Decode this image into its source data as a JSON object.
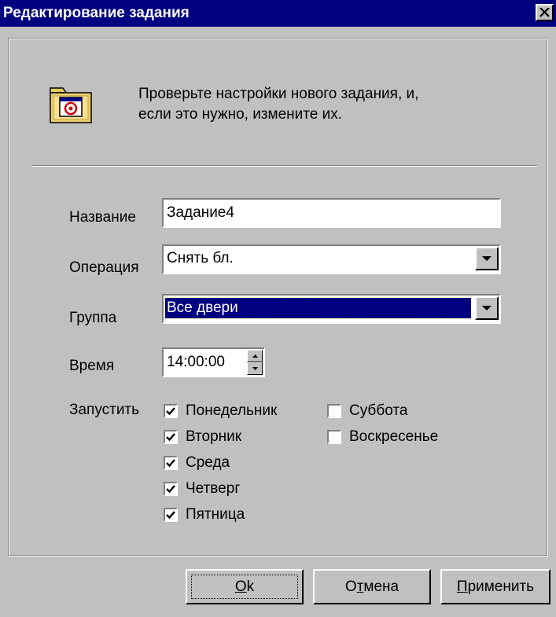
{
  "window": {
    "title": "Редактирование задания",
    "close_icon": "close-icon"
  },
  "header": {
    "icon": "folder-schedule-icon",
    "text_line1": "Проверьте настройки нового задания, и,",
    "text_line2": "если это нужно, измените их."
  },
  "form": {
    "name_label": "Название",
    "name_value": "Задание4",
    "operation_label": "Операция",
    "operation_value": "Снять бл.",
    "group_label": "Группа",
    "group_value": "Все двери",
    "time_label": "Время",
    "time_value": "14:00:00",
    "run_label": "Запустить"
  },
  "days": [
    {
      "label": "Понедельник",
      "checked": true
    },
    {
      "label": "Вторник",
      "checked": true
    },
    {
      "label": "Среда",
      "checked": true
    },
    {
      "label": "Четверг",
      "checked": true
    },
    {
      "label": "Пятница",
      "checked": true
    },
    {
      "label": "Суббота",
      "checked": false
    },
    {
      "label": "Воскресенье",
      "checked": false
    }
  ],
  "buttons": {
    "ok_hotkey": "O",
    "ok_rest": "k",
    "cancel_pre": "О",
    "cancel_hotkey": "т",
    "cancel_rest": "мена",
    "apply_hotkey": "П",
    "apply_rest": "рименить"
  },
  "colors": {
    "face": "#c0c0c0",
    "title_bar": "#000080",
    "selection": "#000080"
  }
}
